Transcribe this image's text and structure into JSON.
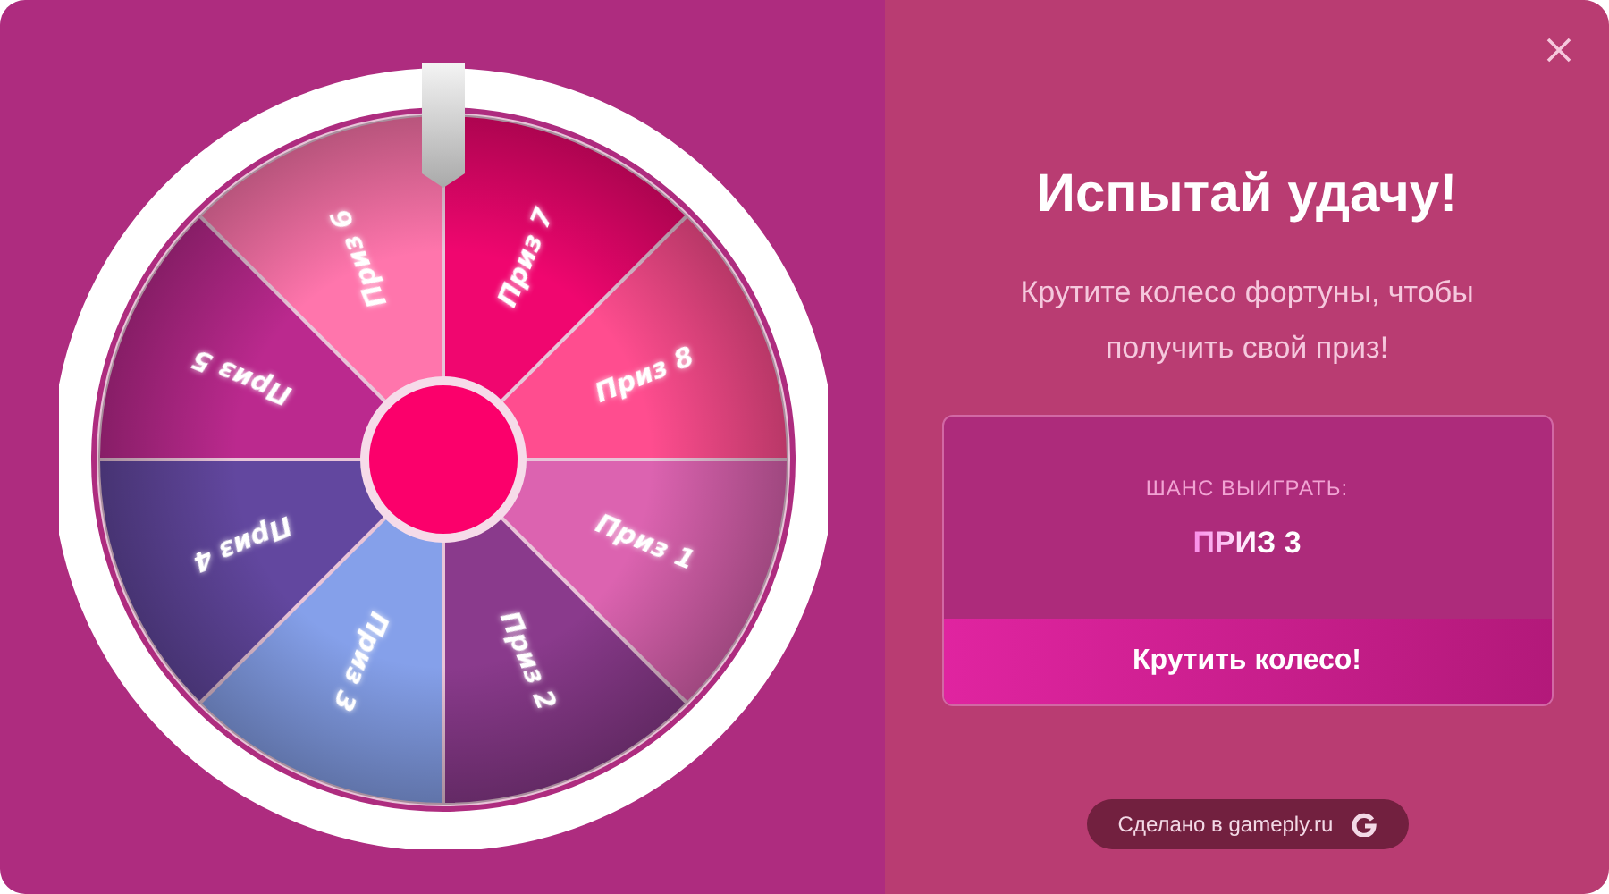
{
  "wheel": {
    "segments": [
      {
        "label": "Приз 7",
        "color": "#f0066f"
      },
      {
        "label": "Приз 8",
        "color": "#ff4d8f"
      },
      {
        "label": "Приз 1",
        "color": "#dc63b0"
      },
      {
        "label": "Приз 2",
        "color": "#8a3a8c"
      },
      {
        "label": "Приз 3",
        "color": "#85a0ea"
      },
      {
        "label": "Приз 4",
        "color": "#62479f"
      },
      {
        "label": "Приз 5",
        "color": "#bb298e"
      },
      {
        "label": "Приз 6",
        "color": "#ff75ac"
      }
    ]
  },
  "title": "Испытай удачу!",
  "subtitle": "Крутите колесо фортуны, чтобы получить свой приз!",
  "chance": {
    "label": "ШАНС ВЫИГРАТЬ:",
    "prize": "ПРИЗ 3"
  },
  "spin_button": "Крутить колесо!",
  "footer": "Сделано в gameply.ru"
}
